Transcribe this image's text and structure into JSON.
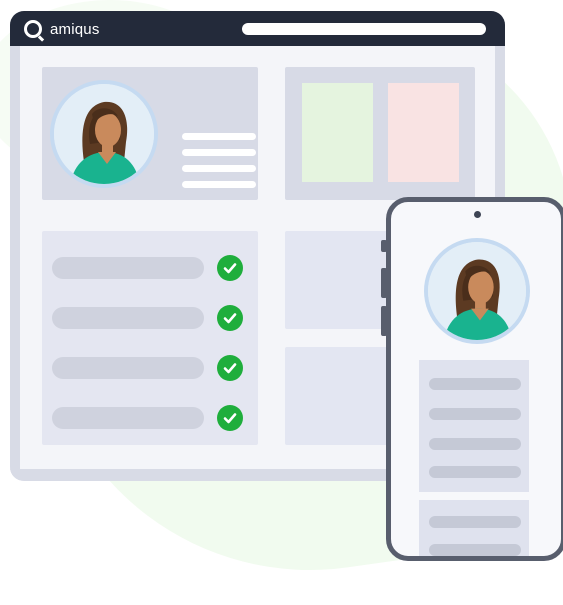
{
  "app": {
    "brand": "amiqus",
    "icons": {
      "logo": "amiqus-logo-icon",
      "check": "check-circle-icon",
      "avatar": "person-avatar-icon"
    }
  },
  "colors": {
    "titlebar": "#232a3a",
    "window_frame": "#d8dbe6",
    "check_green": "#1fae3c",
    "card_green": "#e5f4df",
    "card_pink": "#f9e3e3",
    "phone_frame": "#585e6d"
  },
  "checklist": {
    "items": 4,
    "all_checked": true
  }
}
